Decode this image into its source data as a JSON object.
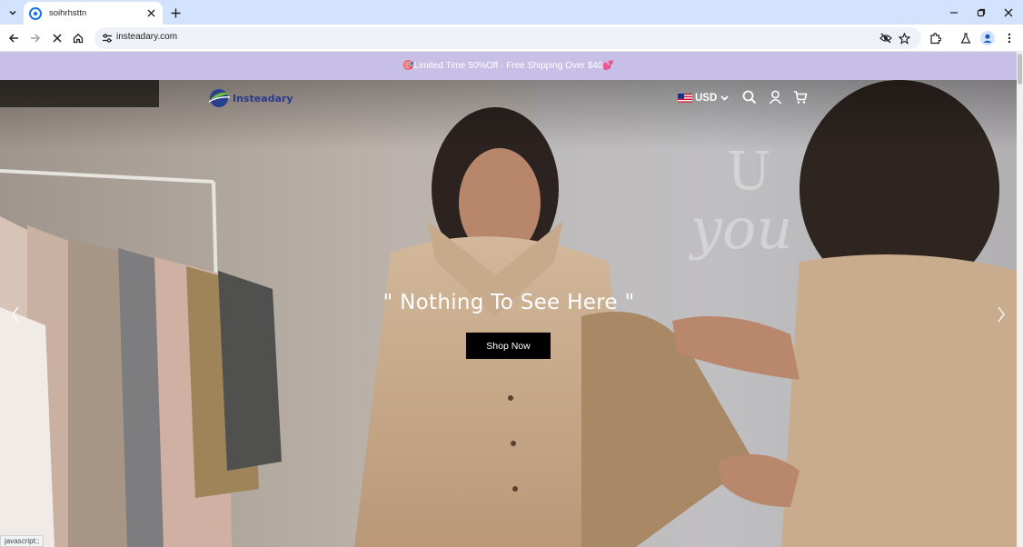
{
  "browser": {
    "tab": {
      "title": "soihrhsttn"
    },
    "url": "insteadary.com",
    "icons": {
      "tab_search": "chevron-down-icon",
      "favicon": "site-favicon",
      "close_tab": "close-icon",
      "new_tab": "plus-icon",
      "minimize": "minimize-icon",
      "restore": "restore-icon",
      "close_window": "close-icon",
      "back": "arrow-left-icon",
      "forward": "arrow-right-icon",
      "stop": "close-icon",
      "home": "home-icon",
      "site_info": "tune-icon",
      "tracking": "eye-off-icon",
      "bookmark": "star-icon",
      "extensions": "puzzle-icon",
      "labs": "flask-icon",
      "profile": "person-icon",
      "menu": "kebab-menu-icon"
    },
    "status_text": "javascript:;"
  },
  "site": {
    "announcement": {
      "prefix_emoji": "🎯",
      "text": "Limited Time 50%Off - Free Shipping Over $40",
      "suffix_emoji": "💕"
    },
    "header": {
      "logo_text": "Insteadary",
      "currency": "USD",
      "icons": {
        "flag": "us-flag-icon",
        "chevron": "chevron-down-icon",
        "search": "search-icon",
        "account": "user-icon",
        "cart": "cart-icon"
      }
    },
    "hero": {
      "title": "\" Nothing To See Here \"",
      "button": "Shop Now",
      "icons": {
        "prev": "chevron-left-icon",
        "next": "chevron-right-icon"
      }
    }
  },
  "colors": {
    "tabstrip": "#d3e3fd",
    "announcement_bg": "#c8bfe6",
    "button_bg": "#000000",
    "logo_text": "#2a3a8c"
  }
}
